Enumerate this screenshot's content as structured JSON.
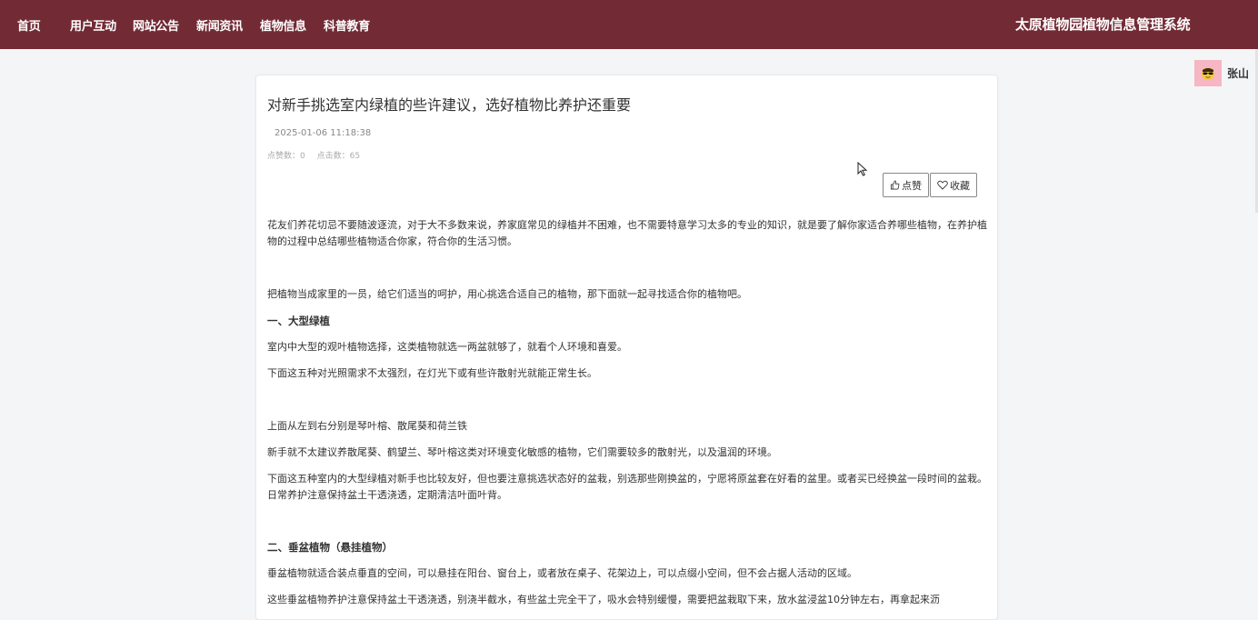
{
  "nav": {
    "items": [
      {
        "label": "首页"
      },
      {
        "label": "用户互动"
      },
      {
        "label": "网站公告"
      },
      {
        "label": "新闻资讯"
      },
      {
        "label": "植物信息"
      },
      {
        "label": "科普教育"
      }
    ],
    "site_title": "太原植物园植物信息管理系统"
  },
  "user": {
    "name": "张山",
    "avatar_icon": "sunglasses-face-icon"
  },
  "article": {
    "title": "对新手挑选室内绿植的些许建议，选好植物比养护还重要",
    "date": "2025-01-06 11:18:38",
    "likes_label": "点赞数：0",
    "clicks_label": "点击数：65",
    "like_button": "点赞",
    "favorite_button": "收藏",
    "paragraphs": [
      "花友们养花切忌不要随波逐流，对于大不多数来说，养家庭常见的绿植并不困难，也不需要特意学习太多的专业的知识，就是要了解你家适合养哪些植物，在养护植物的过程中总结哪些植物适合你家，符合你的生活习惯。",
      "把植物当成家里的一员，给它们适当的呵护，用心挑选合适自己的植物，那下面就一起寻找适合你的植物吧。",
      "一、大型绿植",
      "室内中大型的观叶植物选择，这类植物就选一两盆就够了，就看个人环境和喜爱。",
      "下面这五种对光照需求不太强烈，在灯光下或有些许散射光就能正常生长。",
      "上面从左到右分别是琴叶榕、散尾葵和荷兰铁",
      "新手就不太建议养散尾葵、鹤望兰、琴叶榕这类对环境变化敏感的植物，它们需要较多的散射光，以及温润的环境。",
      "下面这五种室内的大型绿植对新手也比较友好，但也要注意挑选状态好的盆栽，别选那些刚换盆的，宁愿将原盆套在好看的盆里。或者买已经换盆一段时间的盆栽。日常养护注意保持盆土干透浇透，定期清洁叶面叶背。",
      "二、垂盆植物（悬挂植物）",
      "垂盆植物就适合装点垂直的空间，可以悬挂在阳台、窗台上，或者放在桌子、花架边上，可以点缀小空间，但不会占据人活动的区域。",
      "这些垂盆植物养护注意保持盆土干透浇透，别浇半截水，有些盆土完全干了，吸水会特别缓慢，需要把盆栽取下来，放水盆浸盆10分钟左右，再拿起来沥"
    ]
  },
  "colors": {
    "header_bg": "#722b35",
    "page_bg": "#f4f5f7",
    "avatar_bg": "#f6b6c4"
  }
}
